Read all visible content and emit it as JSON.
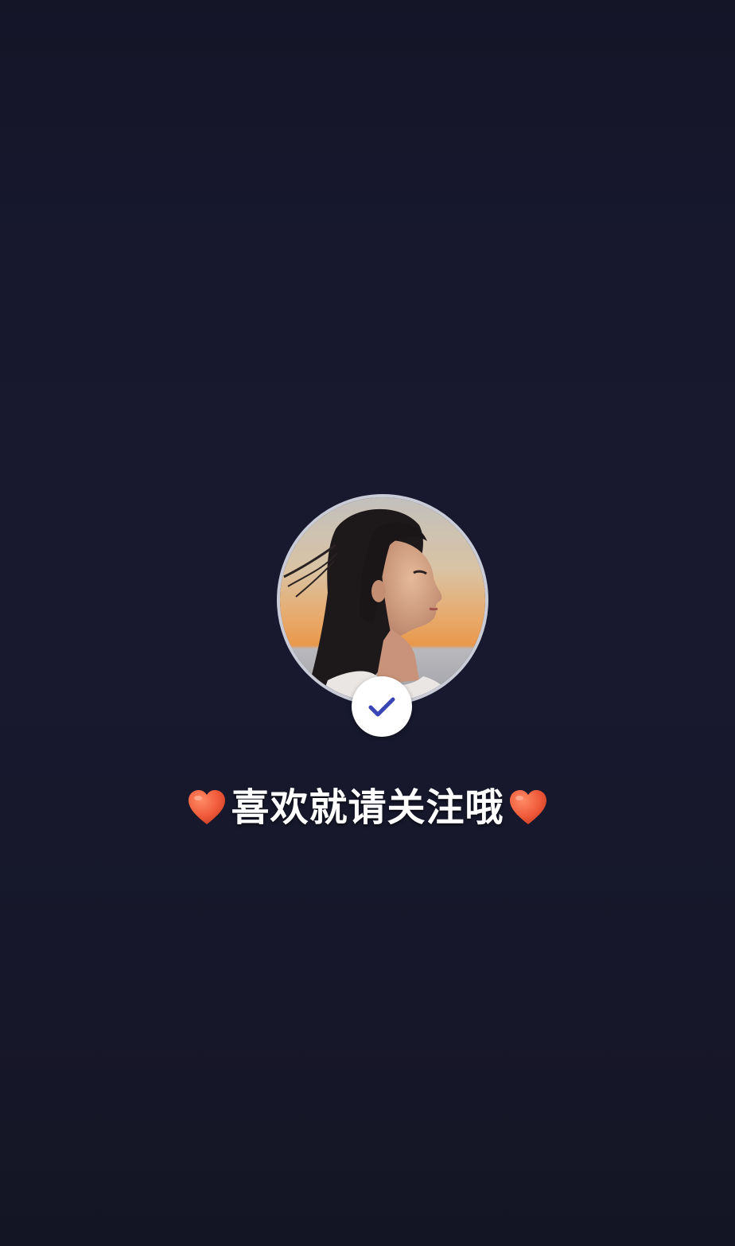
{
  "avatar": {
    "icon": "profile-photo",
    "description_colors": {
      "sky_top": "#c7c1b8",
      "sky_mid": "#e3b27a",
      "sky_low": "#e89a4e",
      "sea": "#b8b9bd",
      "hair": "#1f1a1a",
      "skin": "#d7a98c",
      "ring": "#c9cbd6"
    }
  },
  "follow_badge": {
    "icon": "checkmark-icon",
    "check_color": "#3a46b5",
    "background": "#ffffff"
  },
  "caption": {
    "left_emoji": "heart-emoji",
    "text": "喜欢就请关注哦",
    "right_emoji": "heart-emoji",
    "heart_color": "#ef5a3a"
  },
  "background_color": "#17182e"
}
